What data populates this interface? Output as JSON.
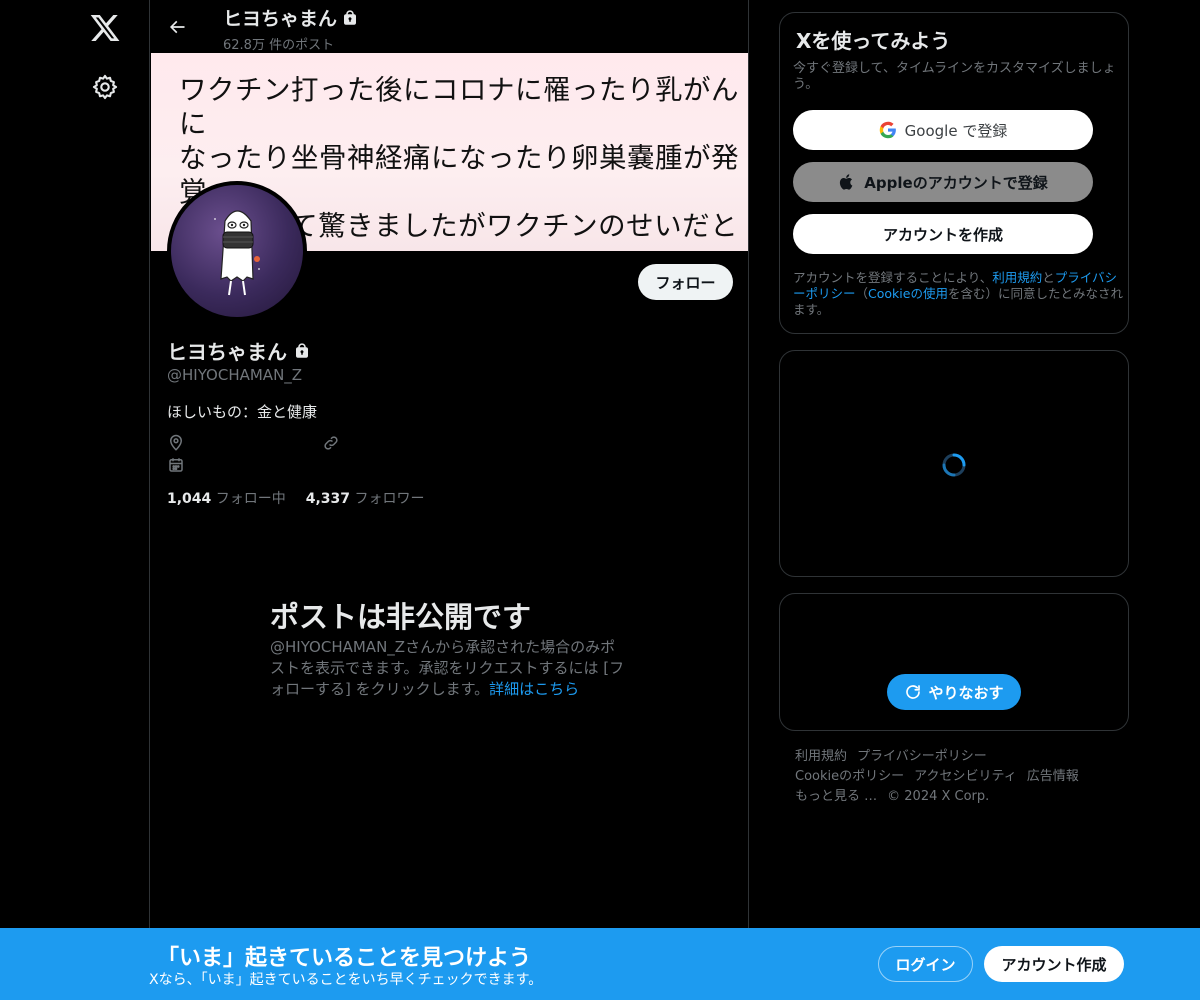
{
  "nav": {
    "logo_icon": "x-logo-icon",
    "settings_icon": "gear-icon"
  },
  "header": {
    "name": "ヒヨちゃまん",
    "post_count": "62.8万 件のポスト"
  },
  "banner": {
    "text": "ワクチン打った後にコロナに罹ったり乳がんに\nなったり坐骨神経痛になったり卵巣嚢腫が発覚\nしたりして驚きましたがワクチンのせいだとは\n一つも思わんので反ワクチンさんは回れ右して\n　　　　　下さい美味しくない飴あげるから"
  },
  "profile": {
    "name": "ヒヨちゃまん",
    "handle": "@HIYOCHAMAN_Z",
    "bio": "ほしいもの：金と健康",
    "follow_label": "フォロー",
    "following_count": "1,044",
    "following_label": "フォロー中",
    "followers_count": "4,337",
    "followers_label": "フォロワー"
  },
  "private": {
    "title": "ポストは非公開です",
    "description": "@HIYOCHAMAN_Zさんから承認された場合のみポストを表示できます。承認をリクエストするには [フォローする] をクリックします。",
    "link": "詳細はこちら"
  },
  "signup": {
    "title": "Xを使ってみよう",
    "subtitle": "今すぐ登録して、タイムラインをカスタマイズしましょう。",
    "google_label": "Google で登録",
    "apple_label": "Appleのアカウントで登録",
    "create_label": "アカウントを作成",
    "terms_pre": "アカウントを登録することにより、",
    "terms_link1": "利用規約",
    "terms_mid1": "と",
    "terms_link2": "プライバシーポリシー",
    "terms_mid2": "（",
    "terms_link3": "Cookieの使用",
    "terms_post": "を含む）に同意したとみなされます。"
  },
  "retry": {
    "label": "やりなおす"
  },
  "footer": {
    "links": [
      "利用規約",
      "プライバシーポリシー",
      "Cookieのポリシー",
      "アクセシビリティ",
      "広告情報",
      "もっと見る …"
    ],
    "copyright": "© 2024 X Corp."
  },
  "bottombar": {
    "title": "「いま」起きていることを見つけよう",
    "subtitle": "Xなら、「いま」起きていることをいち早くチェックできます。",
    "login_label": "ログイン",
    "create_label": "アカウント作成"
  },
  "colors": {
    "accent": "#1d9bf0",
    "background": "#000000",
    "border": "#2f3336",
    "muted": "#71767b"
  }
}
